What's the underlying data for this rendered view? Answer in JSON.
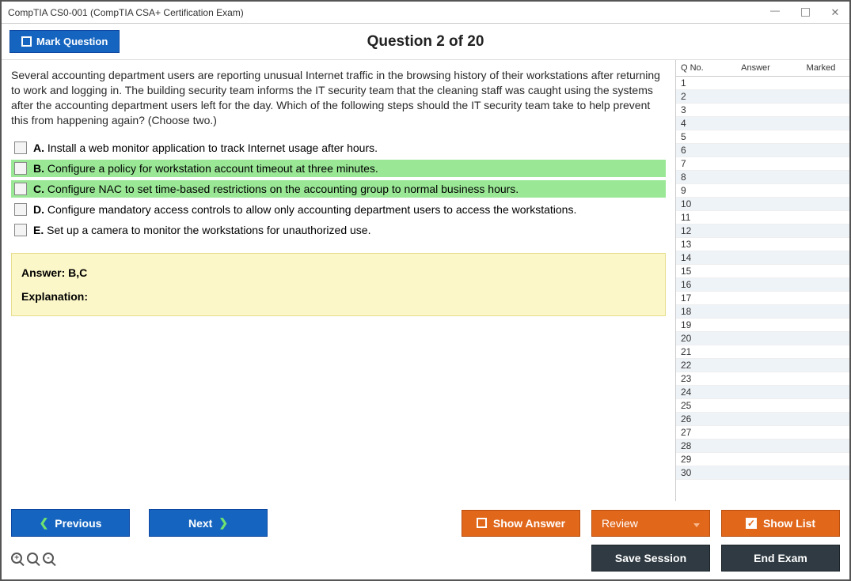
{
  "window": {
    "title": "CompTIA CS0-001 (CompTIA CSA+ Certification Exam)"
  },
  "header": {
    "mark_label": "Mark Question",
    "question_title": "Question 2 of 20"
  },
  "question": {
    "stem": "Several accounting department users are reporting unusual Internet traffic in the browsing history of their workstations after returning to work and logging in. The building security team informs the IT security team that the cleaning staff was caught using the systems after the accounting department users left for the day. Which of the following steps should the IT security team take to help prevent this from happening again? (Choose two.)",
    "options": [
      {
        "letter": "A.",
        "text": "Install a web monitor application to track Internet usage after hours.",
        "correct": false
      },
      {
        "letter": "B.",
        "text": "Configure a policy for workstation account timeout at three minutes.",
        "correct": true
      },
      {
        "letter": "C.",
        "text": "Configure NAC to set time-based restrictions on the accounting group to normal business hours.",
        "correct": true
      },
      {
        "letter": "D.",
        "text": "Configure mandatory access controls to allow only accounting department users to access the workstations.",
        "correct": false
      },
      {
        "letter": "E.",
        "text": "Set up a camera to monitor the workstations for unauthorized use.",
        "correct": false
      }
    ]
  },
  "answer_panel": {
    "answer_label": "Answer: ",
    "answer_value": "B,C",
    "explanation_label": "Explanation:"
  },
  "sidebar": {
    "headers": {
      "qno": "Q No.",
      "answer": "Answer",
      "marked": "Marked"
    },
    "total_rows": 30
  },
  "footer": {
    "previous": "Previous",
    "next": "Next",
    "show_answer": "Show Answer",
    "review": "Review",
    "show_list": "Show List",
    "save_session": "Save Session",
    "end_exam": "End Exam"
  }
}
